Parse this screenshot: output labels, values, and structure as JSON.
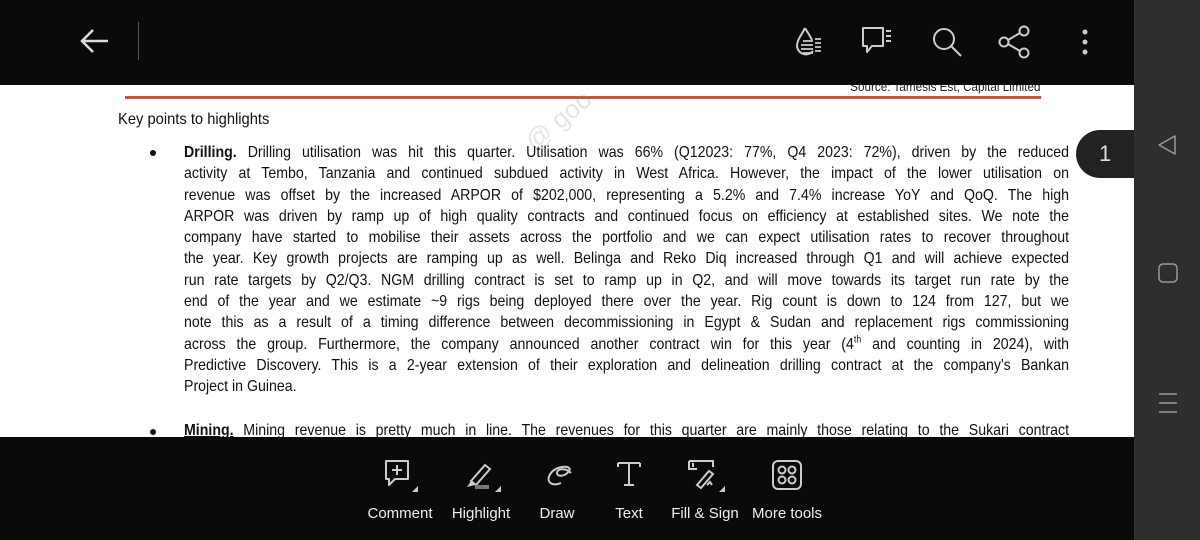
{
  "top_bar": {
    "icons": [
      "back-arrow-icon",
      "liquid-mode-icon",
      "comments-list-icon",
      "search-icon",
      "share-icon",
      "more-vertical-icon"
    ]
  },
  "document": {
    "source": "Source: Tamesis Est, Capital Limited",
    "heading": "Key points to highlights",
    "watermark": "@ goo",
    "drilling": {
      "title": "Drilling.",
      "lines": [
        "Drilling utilisation was hit this quarter. Utilisation was 66% (Q12023: 77%, Q4 2023: 72%), driven by the reduced",
        "activity at Tembo, Tanzania and continued subdued activity in West Africa. However, the impact of the lower utilisation on",
        "revenue was offset by the increased ARPOR of $202,000, representing a 5.2% and 7.4% increase YoY and QoQ. The high",
        "ARPOR was driven by ramp up of high quality contracts and continued focus on efficiency at established sites. We note the",
        "company have started to mobilise their assets across the portfolio and we can expect utilisation rates to recover throughout",
        "the year. Key growth projects are ramping up as well. Belinga and Reko Diq increased through Q1 and will achieve expected",
        "run rate targets by Q2/Q3. NGM drilling contract is set to ramp up in Q2, and will move towards its target run rate by the",
        "end of the year and we estimate ~9 rigs being deployed there over the year. Rig count is down to 124 from 127, but we",
        "note this as a result of a timing difference between decommissioning in Egypt & Sudan and replacement rigs commissioning"
      ],
      "line10_before": "across the group. Furthermore, the company announced another contract win for this year (4",
      "line10_sup": "th",
      "line10_after": " and counting in 2024), with",
      "line11": "Predictive Discovery. This is a 2-year extension of their exploration and delineation drilling contract at the company's Bankan",
      "line12": "Project in Guinea."
    },
    "mining": {
      "title": "Mining.",
      "text": "Mining revenue is pretty much in line. The revenues for this quarter are mainly those relating to the Sukari contract"
    },
    "page_number": "1"
  },
  "toolbar": {
    "comment": "Comment",
    "highlight": "Highlight",
    "draw": "Draw",
    "text": "Text",
    "fill_sign": "Fill & Sign",
    "more_tools": "More tools"
  },
  "nav": {
    "icons": [
      "nav-back-icon",
      "nav-home-icon",
      "nav-recents-icon"
    ]
  },
  "colors": {
    "accent_rule": "#c55a32",
    "bar": "#0a0a0a",
    "nav": "#2e2e2e"
  }
}
